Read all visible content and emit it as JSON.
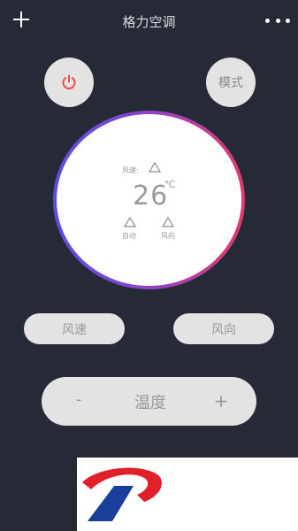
{
  "header": {
    "title": "格力空调",
    "add_icon": "plus-icon",
    "more_icon": "more-icon"
  },
  "controls": {
    "power_icon": "power-icon",
    "power_color": "#e84a4a",
    "mode_label": "模式"
  },
  "dial": {
    "speed_label": "风速:",
    "temperature": "26",
    "unit": "℃",
    "auto_label": "自动",
    "direction_label": "风向",
    "ring_colors": [
      "#5a4de0",
      "#e23a6a"
    ]
  },
  "buttons": {
    "wind_speed": "风速",
    "wind_direction": "风向"
  },
  "temp_control": {
    "minus": "-",
    "label": "温度",
    "plus": "+"
  },
  "logo": {
    "colors": [
      "#e2202a",
      "#1a3f9a"
    ]
  }
}
